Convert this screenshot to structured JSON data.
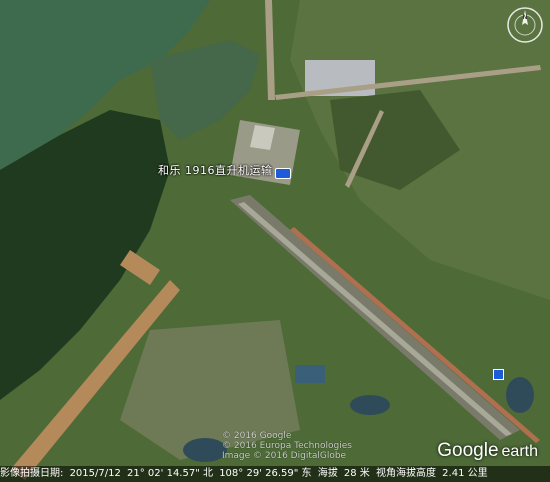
{
  "placemark": {
    "label": "和乐 1916直升机运输"
  },
  "copyright": {
    "line1": "© 2016 Google",
    "line2": "© 2016 Europa Technologies",
    "line3": "Image © 2016 DigitalGlobe"
  },
  "logo": {
    "word1": "Google",
    "word2": "earth"
  },
  "status": {
    "imagery_date_label": "影像拍摄日期:",
    "imagery_date_value": "2015/7/12",
    "lat": "21° 02' 14.57\" 北",
    "lon": "108° 29' 26.59\" 东",
    "elevation_label": "海拔",
    "elevation_value": "28 米",
    "eye_alt_label": "视角海拔高度",
    "eye_alt_value": "2.41 公里"
  },
  "compass": {
    "north_label": "N"
  },
  "colors": {
    "placemark_icon": "#1e5bd8",
    "water": "#3e6a4e"
  }
}
